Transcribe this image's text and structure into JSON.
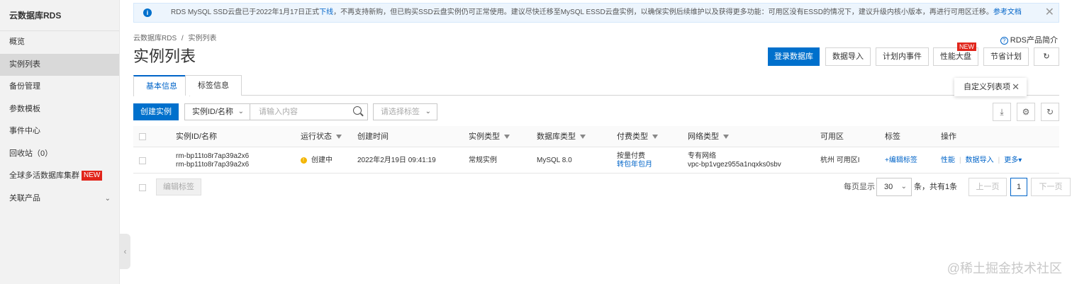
{
  "sidebar": {
    "title": "云数据库RDS",
    "items": [
      {
        "label": "概览"
      },
      {
        "label": "实例列表"
      },
      {
        "label": "备份管理"
      },
      {
        "label": "参数模板"
      },
      {
        "label": "事件中心"
      },
      {
        "label": "回收站（0）"
      },
      {
        "label": "全球多活数据库集群",
        "badge": "NEW"
      },
      {
        "label": "关联产品"
      }
    ]
  },
  "notice": {
    "text_before": "RDS MySQL SSD云盘已于2022年1月17日正式",
    "link1": "下线",
    "text_middle": "，不再支持新购，但已购买SSD云盘实例仍可正常使用。建议尽快迁移至MySQL ESSD云盘实例，以确保实例后续维护以及获得更多功能：可用区没有ESSD的情况下，建议升级内核小版本，再进行可用区迁移。",
    "link2": "参考文档"
  },
  "breadcrumb": {
    "root": "云数据库RDS",
    "sep": "/",
    "current": "实例列表"
  },
  "page_title": "实例列表",
  "help_link": "RDS产品简介",
  "actions": {
    "login_db": "登录数据库",
    "import_data": "数据导入",
    "planned_events": "计划内事件",
    "perf_dashboard": "性能大盘",
    "perf_new": "NEW",
    "saving_plan": "节省计划"
  },
  "tabs": {
    "basic": "基本信息",
    "tags": "标签信息"
  },
  "tooltip": "自定义列表项",
  "toolbar": {
    "create": "创建实例",
    "filter_field": "实例ID/名称",
    "search_placeholder": "请输入内容",
    "tag_placeholder": "请选择标签"
  },
  "table": {
    "headers": {
      "id": "实例ID/名称",
      "status": "运行状态",
      "created": "创建时间",
      "type": "实例类型",
      "db_type": "数据库类型",
      "billing": "付费类型",
      "network": "网络类型",
      "zone": "可用区",
      "tags": "标签",
      "ops": "操作"
    },
    "rows": [
      {
        "id": "rm-bp11to8r7ap39a2x6",
        "name": "rm-bp11to8r7ap39a2x6",
        "status": "创建中",
        "created": "2022年2月19日 09:41:19",
        "type": "常规实例",
        "db_type": "MySQL 8.0",
        "billing": "按量付费",
        "billing_link": "转包年包月",
        "network": "专有网络",
        "vpc": "vpc-bp1vgez955a1nqxks0sbv",
        "zone": "杭州 可用区I",
        "tag_link": "+编辑标签",
        "op_perf": "性能",
        "op_import": "数据导入",
        "op_more": "更多"
      }
    ]
  },
  "footer": {
    "edit_tags": "编辑标签",
    "per_page_label": "每页显示",
    "per_page": "30",
    "total": "条，共有1条",
    "prev": "上一页",
    "page": "1",
    "next": "下一页"
  },
  "watermark": "@稀土掘金技术社区"
}
